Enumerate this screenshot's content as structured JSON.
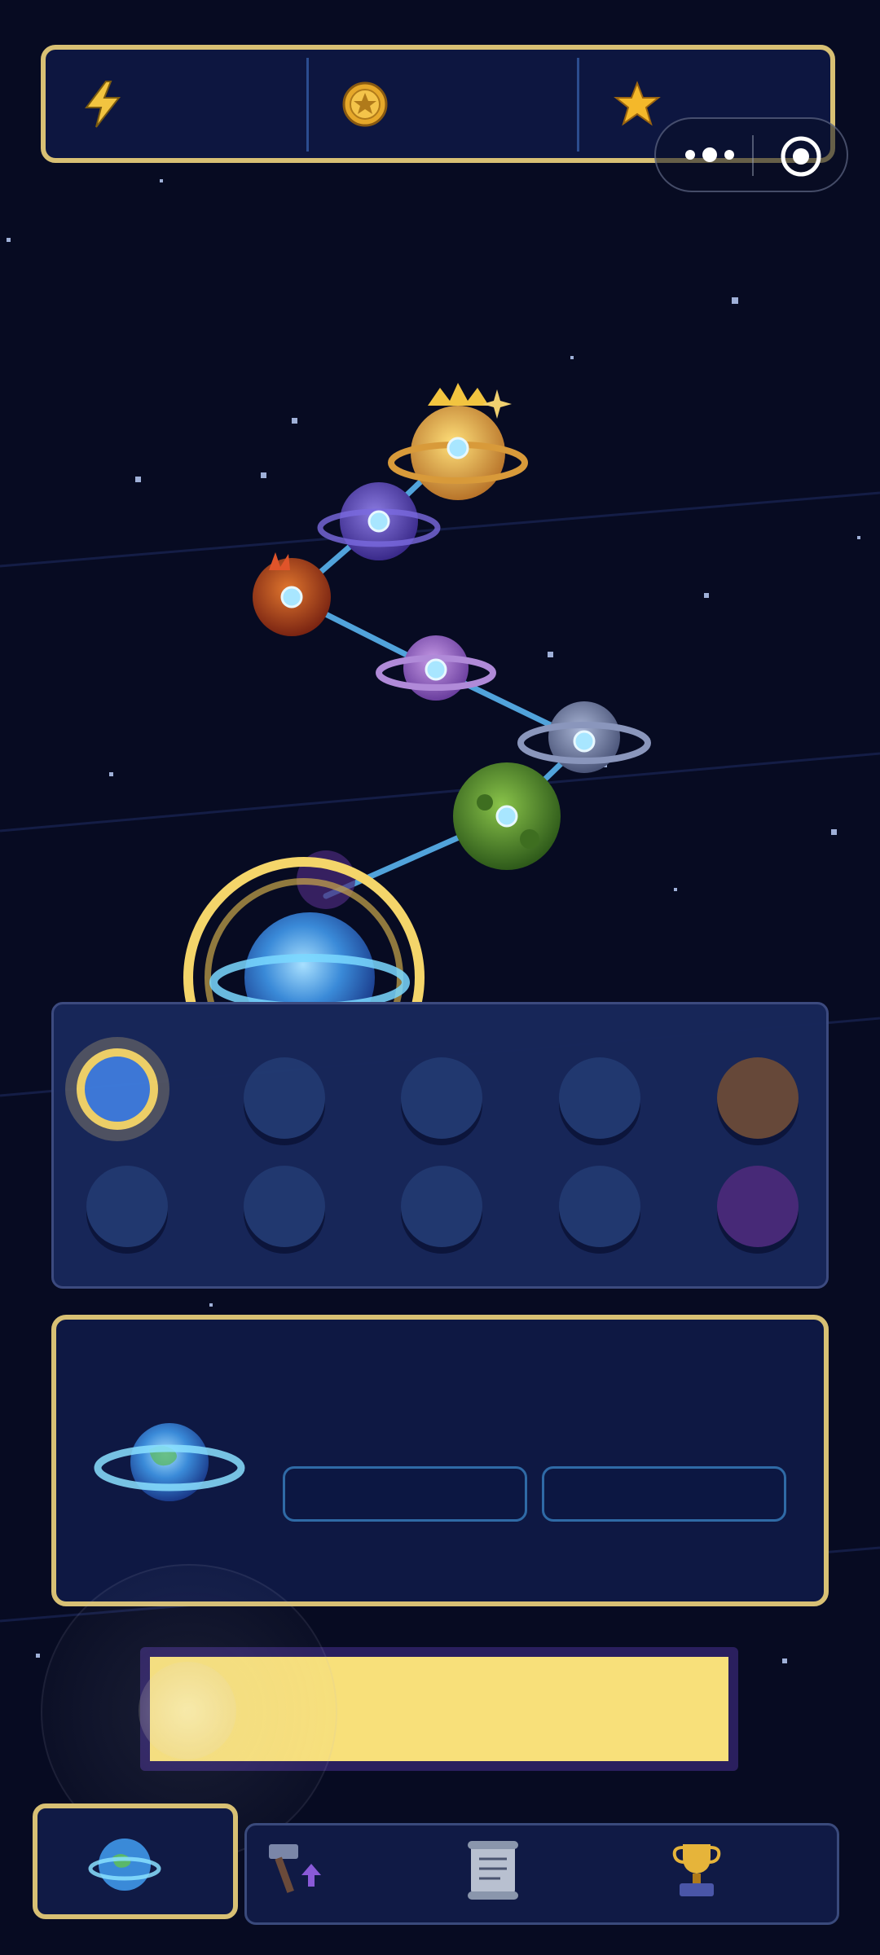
{
  "resources": {
    "energy": {
      "icon": "lightning-icon",
      "value": ""
    },
    "coins": {
      "icon": "coin-icon",
      "value": ""
    },
    "stars": {
      "icon": "star-icon",
      "value": ""
    }
  },
  "system_capsule": {
    "more_icon": "more-dots-icon",
    "close_icon": "close-target-icon"
  },
  "map": {
    "planets": [
      {
        "id": "crowned-golden-planet",
        "kind": "ringed",
        "color": "#e0a43a"
      },
      {
        "id": "violet-nebula-planet",
        "kind": "ringed",
        "color": "#6a4ad0"
      },
      {
        "id": "fiery-red-planet",
        "kind": "plain",
        "color": "#b8441e"
      },
      {
        "id": "lavender-ringed-planet",
        "kind": "ringed",
        "color": "#9a6ad0"
      },
      {
        "id": "grey-ringed-planet",
        "kind": "ringed",
        "color": "#6a7a9e"
      },
      {
        "id": "green-moss-planet",
        "kind": "plain",
        "color": "#4a8a2e"
      },
      {
        "id": "earth-home-planet",
        "kind": "ringed",
        "color": "#4a8ad8",
        "selected": true
      }
    ]
  },
  "color_slots": {
    "row1": [
      "selected-blue",
      "locked",
      "locked",
      "locked",
      "brown"
    ],
    "row2": [
      "locked",
      "locked",
      "locked",
      "locked",
      "purple"
    ],
    "colors": {
      "selected-blue": "#3f7bdc",
      "locked": "#223a72",
      "brown": "#6a4a3a",
      "purple": "#4a2a7a",
      "gold": "#f4d56a"
    }
  },
  "info": {
    "planet_icon": "earth-planet-icon",
    "stat_a": "",
    "stat_b": ""
  },
  "action_button": {
    "label": ""
  },
  "nav": {
    "tabs": [
      {
        "icon": "planet-icon",
        "active": true
      },
      {
        "icon": "hammer-upgrade-icon",
        "active": false
      },
      {
        "icon": "scroll-quest-icon",
        "active": false
      },
      {
        "icon": "trophy-icon",
        "active": false
      }
    ]
  }
}
